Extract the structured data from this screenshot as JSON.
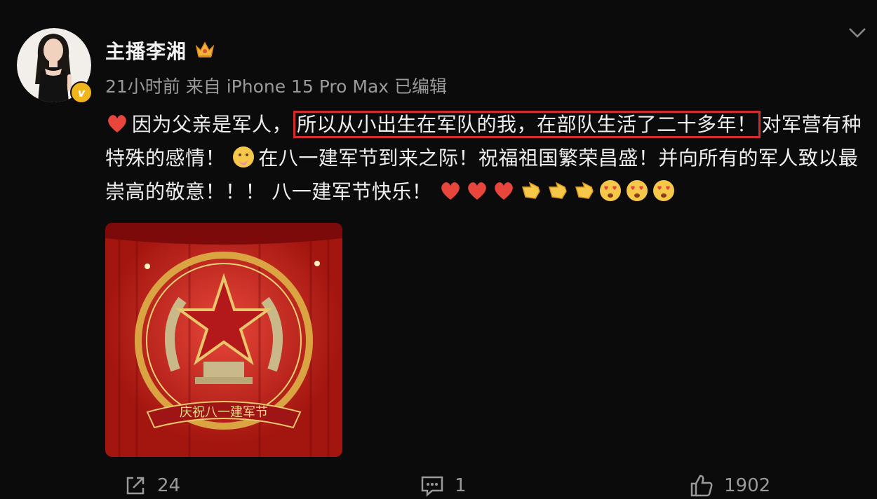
{
  "user": {
    "name": "主播李湘"
  },
  "meta": {
    "text": "21小时前 来自 iPhone 15 Pro Max 已编辑"
  },
  "post": {
    "part1": "因为父亲是军人，",
    "highlight": "所以从小出生在军队的我，在部队生活了二十多年！",
    "part2": "对军营有种特殊的感情！",
    "part3": "在八一建军节到来之际！祝福祖国繁荣昌盛！并向所有的军人致以最崇高的敬意！！！ 八一建军节快乐！"
  },
  "image": {
    "banner": "庆祝八一建军节"
  },
  "actions": {
    "share_count": "24",
    "comment_count": "1",
    "like_count": "1902"
  },
  "colors": {
    "background": "#0b0b0b",
    "highlight_border": "#d42a2a",
    "verified": "#f1b51c",
    "heart": "#e8453c"
  },
  "icons": [
    "verified-badge-icon",
    "crown-icon",
    "chevron-down-icon",
    "heart-emoji",
    "pray-emoji",
    "love-eyes-emoji",
    "share-icon",
    "comment-icon",
    "like-icon"
  ]
}
